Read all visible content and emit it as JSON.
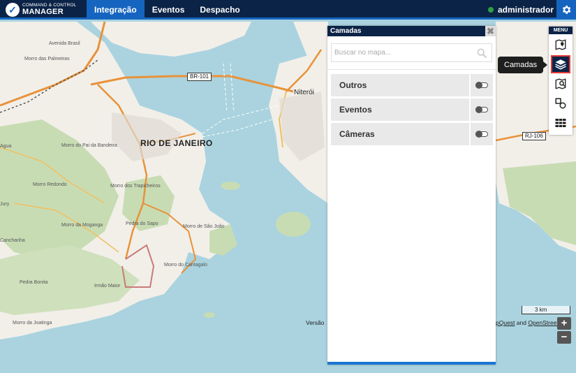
{
  "app": {
    "logo_line1": "COMMAND & CONTROL",
    "logo_line2": "MANAGER",
    "nav": [
      {
        "label": "Integração",
        "active": true
      },
      {
        "label": "Eventos",
        "active": false
      },
      {
        "label": "Despacho",
        "active": false
      }
    ],
    "user": "administrador",
    "status_color": "#2ea043",
    "settings_icon": "gear-icon"
  },
  "map": {
    "labels": {
      "city_rio": "RIO DE JANEIRO",
      "city_niteroi": "Niterói",
      "road_br101": "BR-101",
      "road_rj106": "RJ-106",
      "morro_palmeiras": "Morro das Palmeiras",
      "avenida_brasil": "Avenida Brasil",
      "morro_bandeira": "Morro do Pai da Bandeira",
      "morro_redondo": "Morro Redondo",
      "morro_trapicheiros": "Morro dos Trapicheiros",
      "morro_moganga": "Morro da Moganga",
      "pedra_sapo": "Pedra do Sapo",
      "morro_sao_joao": "Morro de São João",
      "morro_cantagalo": "Morro do Cantagalo",
      "pedra_bonita": "Pedra Bonita",
      "irmao_maior": "Irmão Maior",
      "morro_joatinga": "Morro da Joatinga",
      "canchanha": "Canchanha",
      "agua": "Agua",
      "jury": "Jury"
    },
    "attribution_prefix": "Versão",
    "attribution_mapquest": "pQuest",
    "attribution_and": " and ",
    "attribution_osm": "OpenStreetMap",
    "scale": "3 km",
    "zoom_in": "+",
    "zoom_out": "−"
  },
  "panel": {
    "title": "Camadas",
    "close": "✖",
    "search_placeholder": "Buscar no mapa...",
    "layers": [
      {
        "label": "Outros",
        "enabled": false
      },
      {
        "label": "Eventos",
        "enabled": false
      },
      {
        "label": "Câmeras",
        "enabled": false
      }
    ]
  },
  "menu": {
    "title": "MENU",
    "tooltip": "Camadas",
    "items": [
      {
        "icon": "map-marker-icon"
      },
      {
        "icon": "layers-icon",
        "active": true
      },
      {
        "icon": "map-search-icon"
      },
      {
        "icon": "shapes-icon"
      },
      {
        "icon": "grid-icon"
      }
    ]
  },
  "colors": {
    "header_bg": "#0b2346",
    "accent": "#1565c0",
    "water": "#aad3df",
    "land": "#f2efe9",
    "forest": "#c8dcb4",
    "road": "#e8923a",
    "highlight_border": "#e53935"
  }
}
